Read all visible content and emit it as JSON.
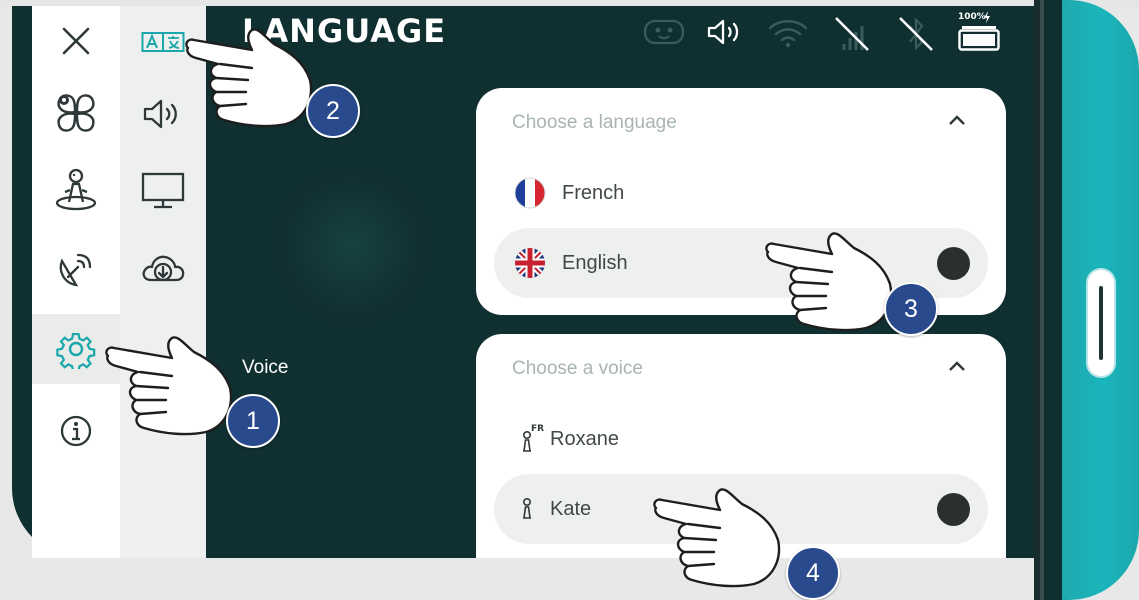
{
  "header": {
    "title": "LANGUAGE",
    "battery_label": "100%"
  },
  "nav_main": {
    "items": [
      {
        "name": "close",
        "icon": "close-icon"
      },
      {
        "name": "apps",
        "icon": "apps-icon"
      },
      {
        "name": "robot",
        "icon": "robot-icon"
      },
      {
        "name": "connectivity",
        "icon": "satellite-icon"
      },
      {
        "name": "settings",
        "icon": "gear-icon",
        "active": true
      },
      {
        "name": "info",
        "icon": "info-icon"
      }
    ]
  },
  "nav_settings": {
    "items": [
      {
        "name": "language",
        "icon": "language-icon",
        "active": true
      },
      {
        "name": "sound",
        "icon": "speaker-icon"
      },
      {
        "name": "display",
        "icon": "monitor-icon"
      },
      {
        "name": "update",
        "icon": "cloud-download-icon"
      }
    ]
  },
  "voice_section_label": "Voice",
  "language_card": {
    "title": "Choose a language",
    "options": [
      {
        "label": "French",
        "flag": "french-flag-icon",
        "selected": false
      },
      {
        "label": "English",
        "flag": "uk-flag-icon",
        "selected": true
      }
    ]
  },
  "voice_card": {
    "title": "Choose a voice",
    "options": [
      {
        "label": "Roxane",
        "icon": "voice-fr-icon",
        "tag": "FR",
        "selected": false
      },
      {
        "label": "Kate",
        "icon": "voice-icon",
        "selected": true
      }
    ]
  },
  "callouts": [
    "1",
    "2",
    "3",
    "4"
  ],
  "colors": {
    "screen_bg": "#0f2f31",
    "accent_teal": "#19b5bb",
    "badge_blue": "#294b8e",
    "icon_teal": "#1aa7ab"
  }
}
